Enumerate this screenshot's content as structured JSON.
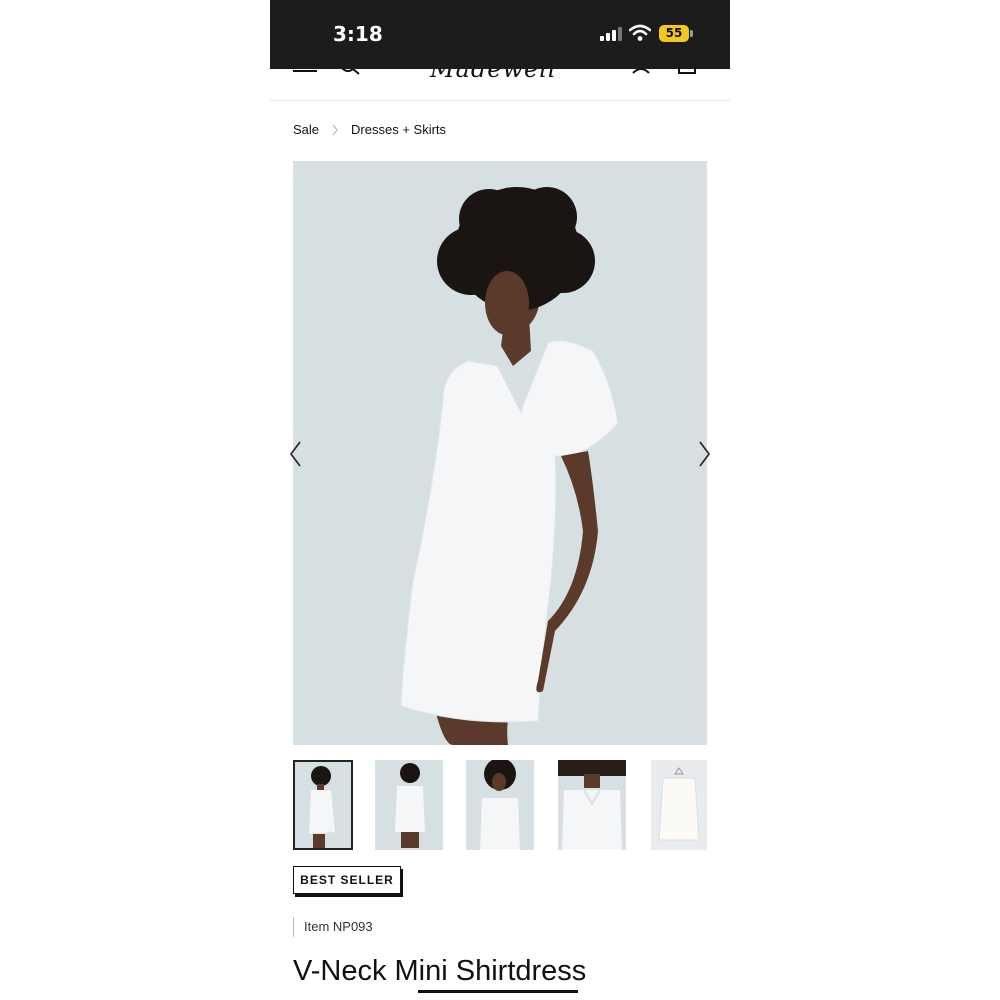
{
  "status_bar": {
    "time": "3:18",
    "battery": "55"
  },
  "nav": {
    "menu_icon": "hamburger-icon",
    "search_icon": "search-icon",
    "account_icon": "user-icon",
    "bag_icon": "bag-icon",
    "logo": "Madewell"
  },
  "breadcrumb": {
    "items": [
      "Sale",
      "Dresses + Skirts"
    ]
  },
  "gallery": {
    "prev_icon": "chevron-left-icon",
    "next_icon": "chevron-right-icon",
    "thumbnail_count": 5,
    "selected_index": 0
  },
  "product": {
    "badge": "BEST SELLER",
    "item_number": "Item NP093",
    "title": "V-Neck Mini Shirtdress"
  },
  "colors": {
    "status_bar_bg": "#1c1c1c",
    "battery": "#f3c623",
    "image_bg": "#d6dfe1"
  }
}
